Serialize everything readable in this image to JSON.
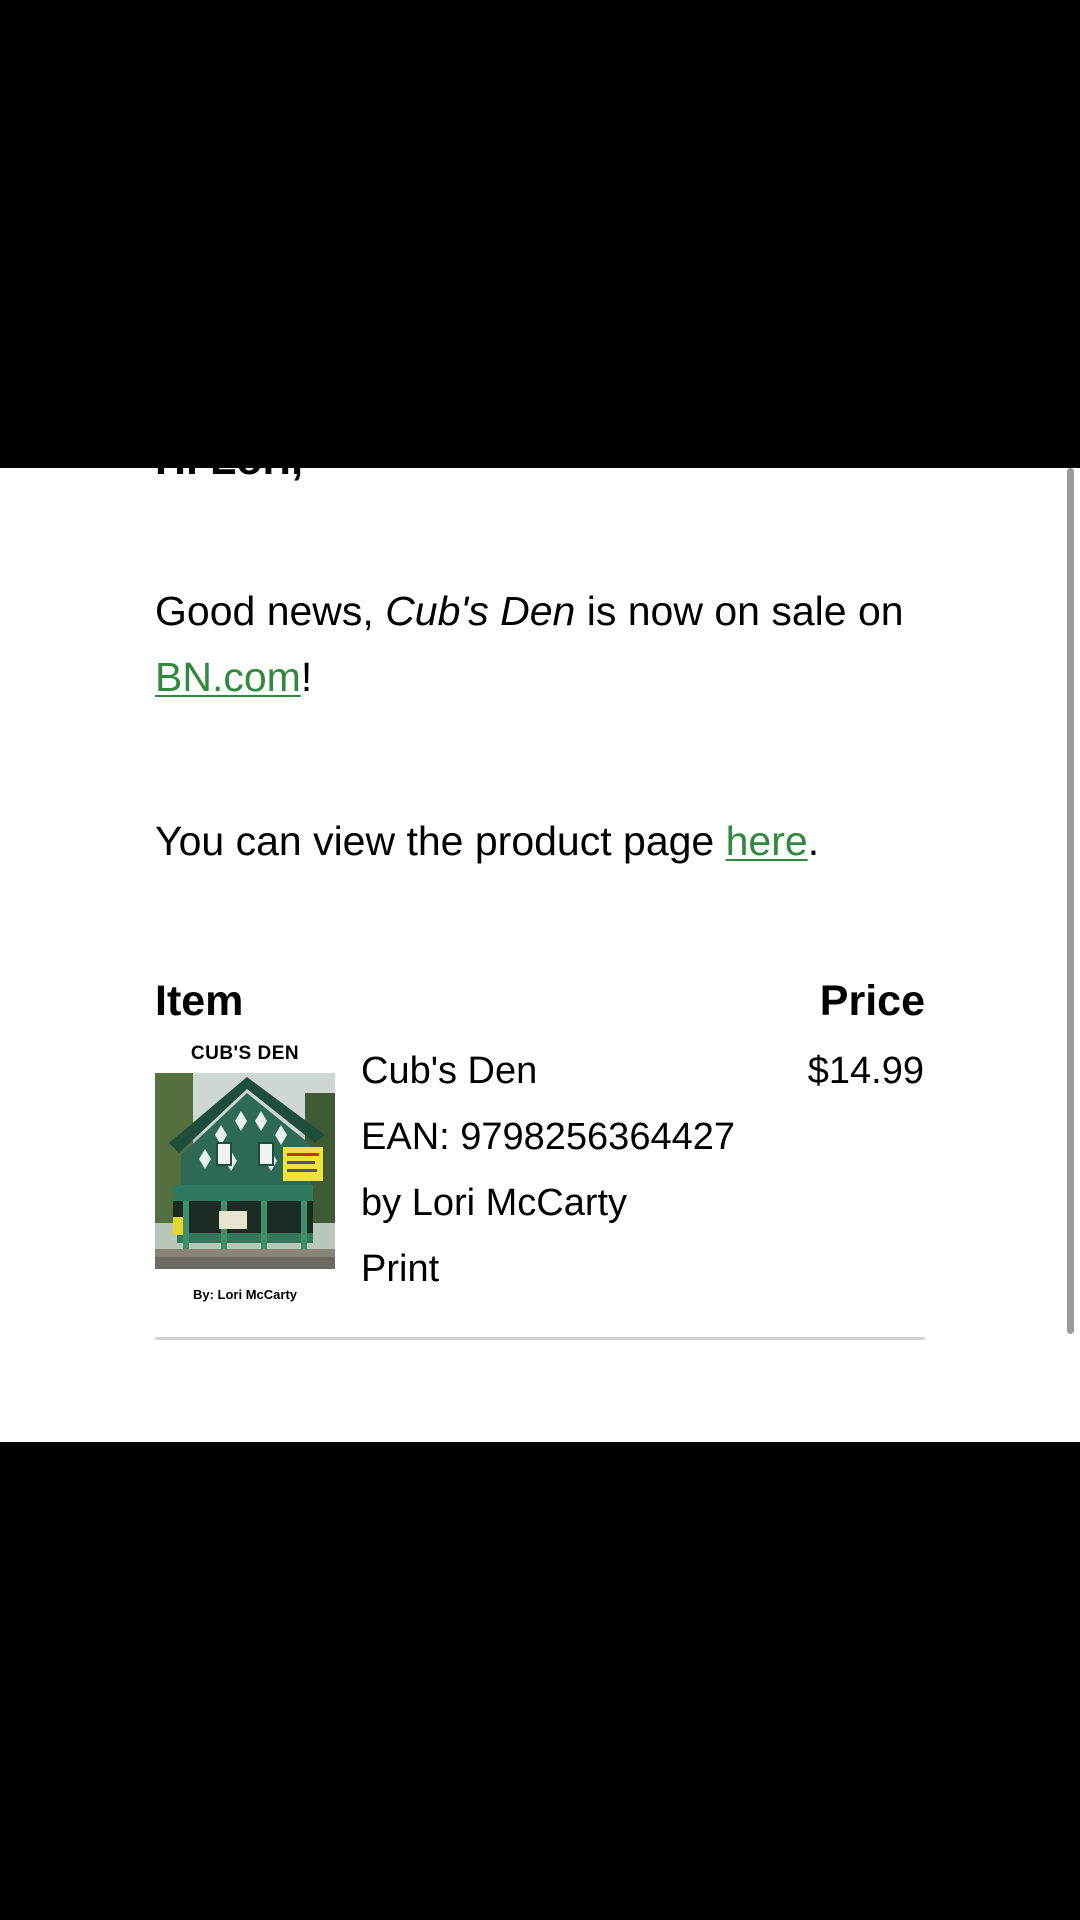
{
  "email": {
    "greeting": "Hi Lori,",
    "paragraph1": {
      "prefix": "Good news, ",
      "title_italic": "Cub's Den",
      "middle": " is now on sale on ",
      "link_text": "BN.com",
      "suffix": "!"
    },
    "paragraph2": {
      "prefix": "You can view the product page ",
      "link_text": "here",
      "suffix": "."
    },
    "table": {
      "header_item": "Item",
      "header_price": "Price",
      "rows": [
        {
          "cover": {
            "title": "CUB'S DEN",
            "author": "By: Lori McCarty"
          },
          "title": "Cub's Den",
          "ean": "EAN: 9798256364427",
          "author": "by Lori McCarty",
          "format": "Print",
          "price": "$14.99"
        }
      ]
    }
  },
  "colors": {
    "link": "#2f8a3e",
    "background": "#ffffff",
    "letterbox": "#000000",
    "divider": "#d3d3d3"
  }
}
